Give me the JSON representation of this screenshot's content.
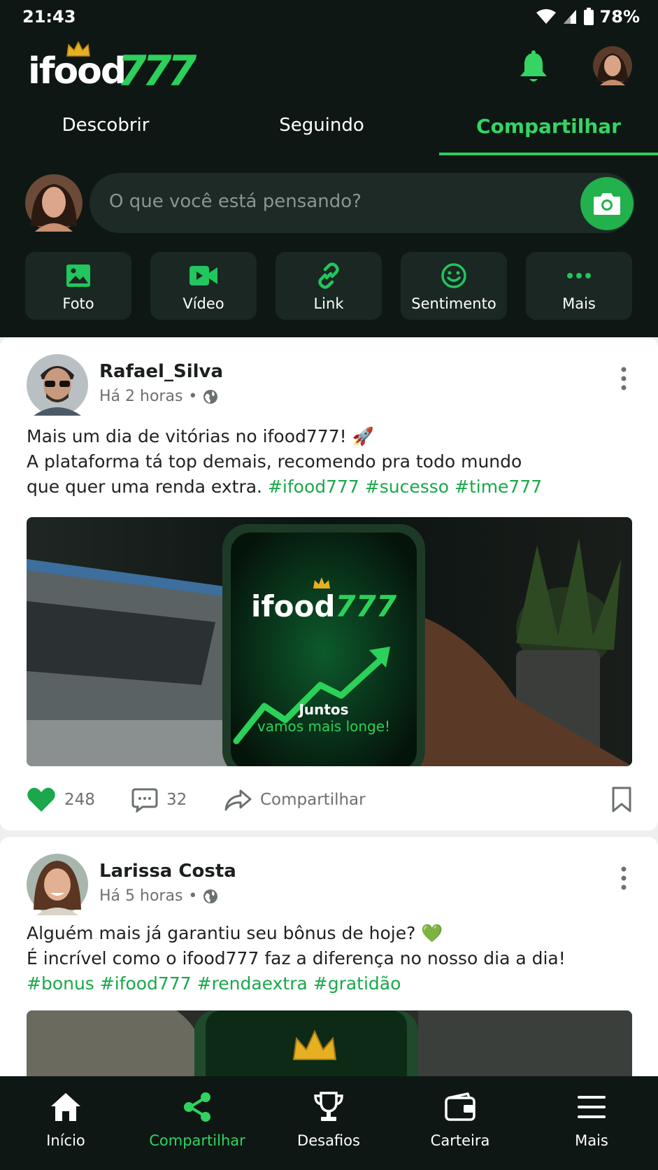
{
  "status": {
    "time": "21:43",
    "battery": "78%"
  },
  "app": {
    "logo_text": "ifood",
    "logo_number": "777"
  },
  "colors": {
    "accent": "#2ecc5e",
    "dark_bg": "#0e1714",
    "hashtag": "#1aa84a",
    "like": "#1aa84a"
  },
  "tabs": [
    {
      "label": "Descobrir"
    },
    {
      "label": "Seguindo"
    },
    {
      "label": "Compartilhar",
      "active": true
    }
  ],
  "composer": {
    "placeholder": "O que você está pensando?"
  },
  "actions": [
    {
      "label": "Foto",
      "icon": "image-icon"
    },
    {
      "label": "Vídeo",
      "icon": "video-icon"
    },
    {
      "label": "Link",
      "icon": "link-icon"
    },
    {
      "label": "Sentimento",
      "icon": "smile-icon"
    },
    {
      "label": "Mais",
      "icon": "more-dots-icon"
    }
  ],
  "posts": [
    {
      "author": "Rafael_Silva",
      "time": "Há 2 horas",
      "line1": "Mais um dia de vitórias no ifood777! 🚀",
      "line2": "A plataforma tá top demais, recomendo pra todo mundo",
      "line3": "que quer uma renda extra.",
      "tags": "#ifood777 #sucesso #time777",
      "image_logo": "ifood777",
      "image_caption1": "Juntos",
      "image_caption2": "vamos mais longe!",
      "likes": "248",
      "comments": "32",
      "share_label": "Compartilhar"
    },
    {
      "author": "Larissa Costa",
      "time": "Há 5 horas",
      "line1": "Alguém mais já garantiu seu bônus de hoje? 💚",
      "line2": "É incrível como o ifood777 faz a diferença no nosso dia a dia!",
      "tags": "#bonus #ifood777 #rendaextra #gratidão"
    }
  ],
  "bottom_nav": [
    {
      "label": "Início",
      "icon": "home-icon"
    },
    {
      "label": "Compartilhar",
      "icon": "share-icon",
      "active": true
    },
    {
      "label": "Desafios",
      "icon": "trophy-icon"
    },
    {
      "label": "Carteira",
      "icon": "wallet-icon"
    },
    {
      "label": "Mais",
      "icon": "menu-icon"
    }
  ]
}
